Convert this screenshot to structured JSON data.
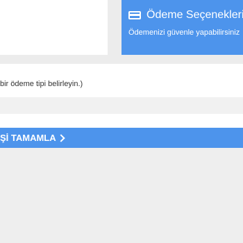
{
  "payment": {
    "title": "Ödeme Seçenekleri",
    "subtitle": "Ödemenizi güvenle yapabilirsiniz",
    "icon": "credit-card-icon"
  },
  "form": {
    "hint": "bir ödeme tipi belirleyin.)"
  },
  "actions": {
    "complete_label": "Şİ TAMAMLA",
    "complete_icon": "chevron-right-icon"
  },
  "colors": {
    "accent": "#4d94ec",
    "background": "#ececec"
  }
}
